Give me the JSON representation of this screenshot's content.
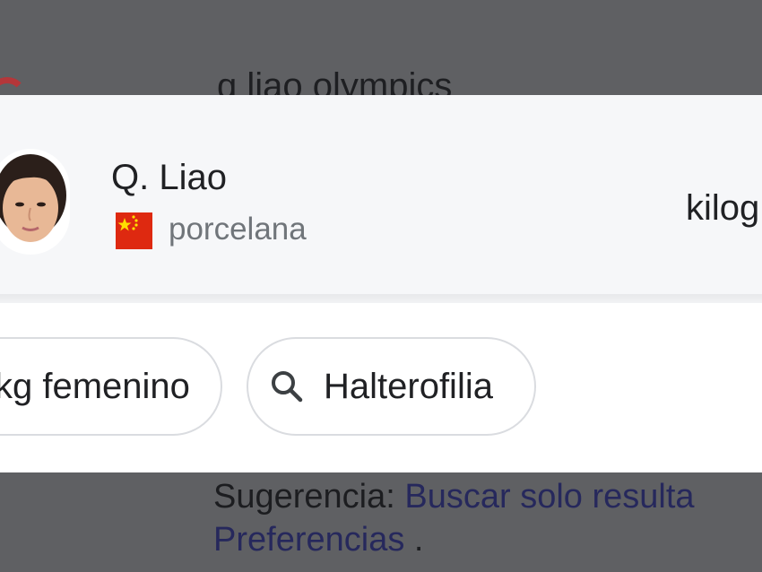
{
  "background": {
    "search_query": "q liao olympics",
    "suggestion_prefix": "Sugerencia:",
    "suggestion_link": "Buscar solo resulta",
    "preferences_link": "Preferencias",
    "preferences_suffix": " ."
  },
  "athlete": {
    "name": "Q. Liao",
    "country": "porcelana",
    "flag_icon": "china-flag-icon",
    "event_text": "kilog"
  },
  "chips": [
    {
      "label": "kg femenino"
    },
    {
      "label": "Halterofilia",
      "icon": "search-icon"
    }
  ],
  "colors": {
    "overlay": "#5f6063",
    "card": "#ffffff",
    "athlete_row": "#f6f7f9",
    "chip_border": "#dadce0",
    "secondary_text": "#70757a",
    "flag_red": "#de2910",
    "flag_yellow": "#ffde00"
  }
}
